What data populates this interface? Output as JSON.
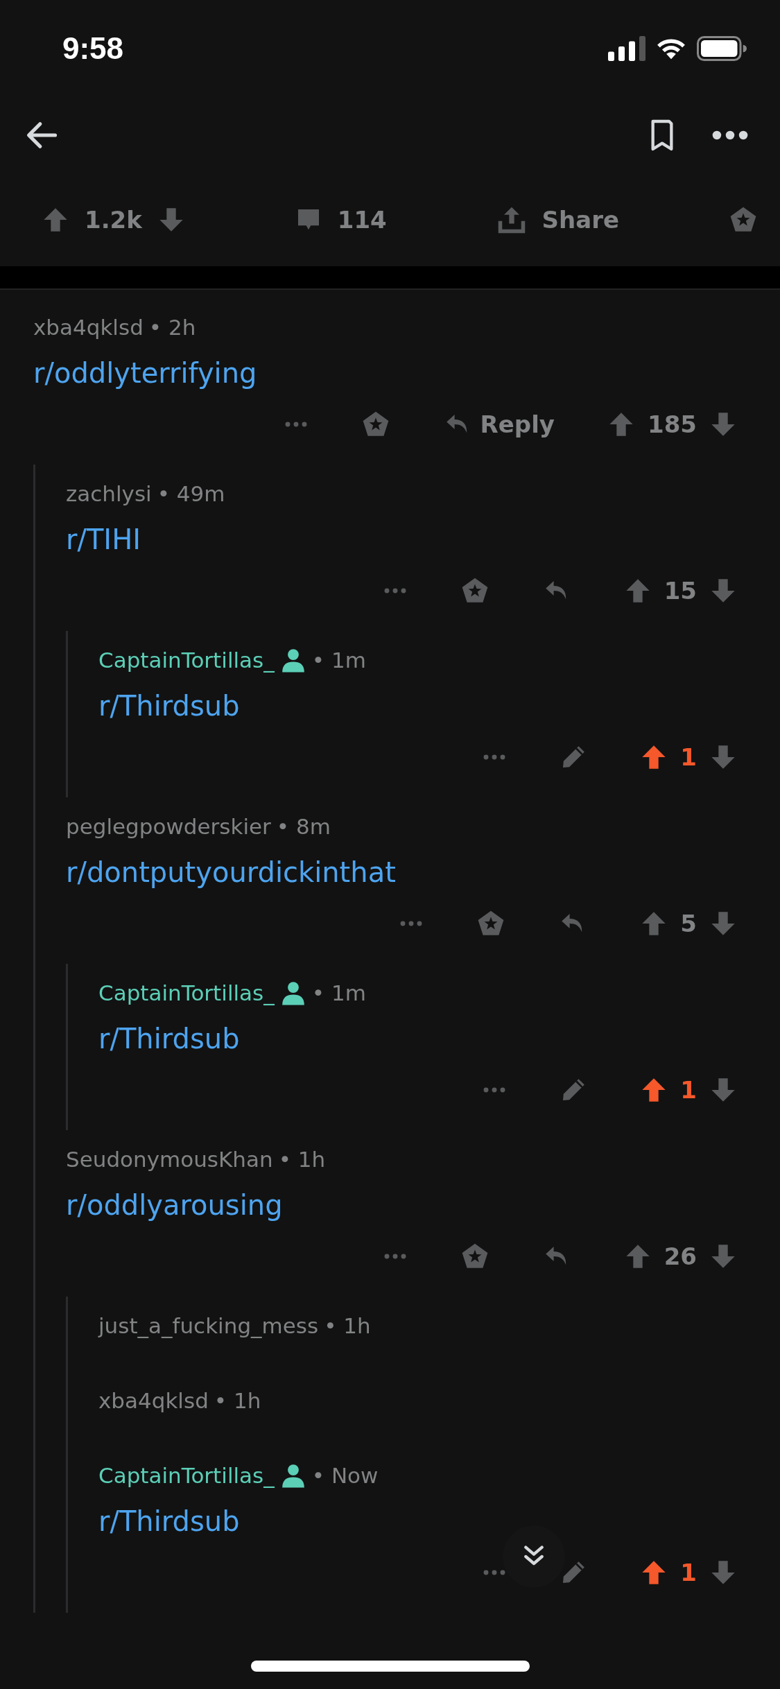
{
  "status_bar": {
    "time": "9:58"
  },
  "post_bar": {
    "score": "1.2k",
    "upvoted": false,
    "comments": "114",
    "share": "Share"
  },
  "comments": [
    {
      "author": "xba4qklsd",
      "op": false,
      "time": "• 2h",
      "body": "r/oddlyterrifying",
      "collapsed": false,
      "actions": [
        {
          "kind": "more"
        },
        {
          "kind": "award"
        },
        {
          "kind": "reply",
          "label": "Reply"
        }
      ],
      "score": "185",
      "upvoted": false,
      "children": [
        {
          "author": "zachlysi",
          "op": false,
          "time": "• 49m",
          "body": "r/TIHI",
          "collapsed": false,
          "actions": [
            {
              "kind": "more"
            },
            {
              "kind": "award"
            },
            {
              "kind": "reply"
            }
          ],
          "score": "15",
          "upvoted": false,
          "children": [
            {
              "author": "CaptainTortillas_",
              "op": true,
              "time": "• 1m",
              "body": "r/Thirdsub",
              "collapsed": false,
              "actions": [
                {
                  "kind": "more"
                },
                {
                  "kind": "edit"
                }
              ],
              "score": "1",
              "upvoted": true
            }
          ]
        },
        {
          "author": "peglegpowderskier",
          "op": false,
          "time": "• 8m",
          "body": "r/dontputyourdickinthat",
          "collapsed": false,
          "actions": [
            {
              "kind": "more"
            },
            {
              "kind": "award"
            },
            {
              "kind": "reply"
            }
          ],
          "score": "5",
          "upvoted": false,
          "children": [
            {
              "author": "CaptainTortillas_",
              "op": true,
              "time": "• 1m",
              "body": "r/Thirdsub",
              "collapsed": false,
              "actions": [
                {
                  "kind": "more"
                },
                {
                  "kind": "edit"
                }
              ],
              "score": "1",
              "upvoted": true
            }
          ]
        },
        {
          "author": "SeudonymousKhan",
          "op": false,
          "time": "• 1h",
          "body": "r/oddlyarousing",
          "collapsed": false,
          "actions": [
            {
              "kind": "more"
            },
            {
              "kind": "award"
            },
            {
              "kind": "reply"
            }
          ],
          "score": "26",
          "upvoted": false,
          "children": [
            {
              "author": "just_a_fucking_mess",
              "op": false,
              "time": "• 1h",
              "collapsed": true
            },
            {
              "author": "xba4qklsd",
              "op": false,
              "time": "• 1h",
              "collapsed": true
            },
            {
              "author": "CaptainTortillas_",
              "op": true,
              "time": "• Now",
              "body": "r/Thirdsub",
              "collapsed": false,
              "actions": [
                {
                  "kind": "more"
                },
                {
                  "kind": "edit"
                }
              ],
              "score": "1",
              "upvoted": true
            }
          ]
        }
      ]
    }
  ]
}
